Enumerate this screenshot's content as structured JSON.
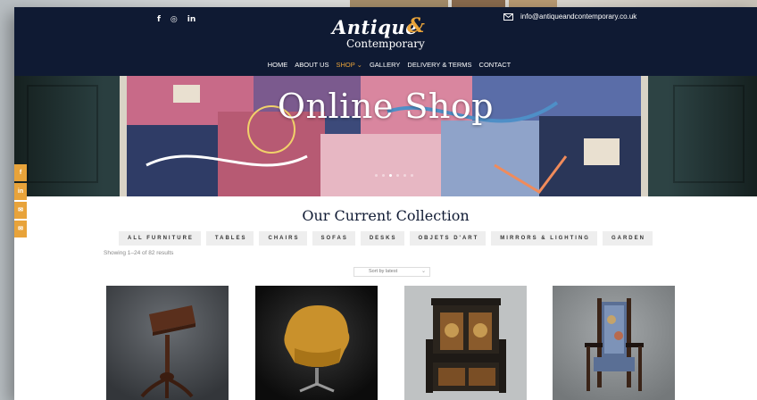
{
  "header": {
    "social_icons": [
      {
        "icon": "facebook-icon",
        "glyph": "f"
      },
      {
        "icon": "instagram-icon",
        "glyph": "◎"
      },
      {
        "icon": "linkedin-icon",
        "glyph": "in"
      }
    ],
    "logo": {
      "main": "Antique",
      "amp": "&",
      "sub": "Contemporary"
    },
    "email": "info@antiqueandcontemporary.co.uk"
  },
  "nav": {
    "items": [
      {
        "label": "HOME"
      },
      {
        "label": "ABOUT US"
      },
      {
        "label": "SHOP ⌄"
      },
      {
        "label": "GALLERY"
      },
      {
        "label": "DELIVERY & TERMS"
      },
      {
        "label": "CONTACT"
      }
    ],
    "active_index": 2
  },
  "hero": {
    "title": "Online Shop",
    "slides": 6,
    "current_slide": 2
  },
  "side_share": [
    {
      "icon": "facebook-icon",
      "glyph": "f"
    },
    {
      "icon": "linkedin-icon",
      "glyph": "in"
    },
    {
      "icon": "mail-icon",
      "glyph": "✉"
    },
    {
      "icon": "mail-icon",
      "glyph": "✉"
    }
  ],
  "collection": {
    "title": "Our Current Collection",
    "categories": [
      "ALL FURNITURE",
      "TABLES",
      "CHAIRS",
      "SOFAS",
      "DESKS",
      "OBJETS D'ART",
      "MIRRORS & LIGHTING",
      "GARDEN"
    ],
    "results_text": "Showing 1–24 of 82 results",
    "sort_label": "Sort by latest"
  },
  "products": [
    {
      "name": "reading-stand",
      "bg": "#4a4d52"
    },
    {
      "name": "swan-chair",
      "bg": "#121212"
    },
    {
      "name": "carved-settle",
      "bg": "#b9bcbd"
    },
    {
      "name": "tapestry-armchair",
      "bg": "#8d9294"
    }
  ],
  "colors": {
    "navy": "#0f1a33",
    "accent": "#e8a33a",
    "chip": "#eeeeee"
  }
}
